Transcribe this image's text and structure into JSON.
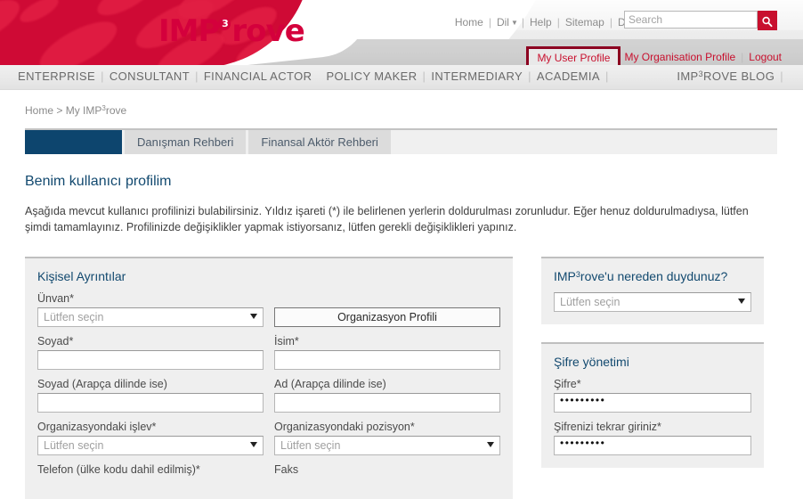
{
  "brand": {
    "logo_main": "IMP",
    "logo_sup": "3",
    "logo_tail": "rove",
    "accent_red": "#c8102e",
    "accent_blue": "#12496f",
    "highlight_border": "#8c0020"
  },
  "header": {
    "util_links": [
      "Home",
      "Dil",
      "Help",
      "Sitemap",
      "Disclaimer"
    ],
    "lang_caret": "▼",
    "search": {
      "placeholder": "Search",
      "value": "",
      "icon": "search-icon"
    },
    "profile_links": {
      "my_user_profile": "My User Profile",
      "my_organisation_profile": "My Organisation Profile",
      "logout": "Logout"
    }
  },
  "mainnav": {
    "left_items": [
      "ENTERPRISE",
      "CONSULTANT",
      "FINANCIAL ACTOR",
      "POLICY MAKER",
      "INTERMEDIARY",
      "ACADEMIA"
    ],
    "right_item": {
      "pre": "IMP",
      "sup": "3",
      "post": "ROVE BLOG"
    }
  },
  "breadcrumb": {
    "home": "Home",
    "separator": ">",
    "current_pre": "My IMP",
    "current_sup": "3",
    "current_post": "rove"
  },
  "tabs": [
    {
      "label": "",
      "active": true
    },
    {
      "label": "Danışman Rehberi",
      "active": false
    },
    {
      "label": "Finansal Aktör Rehberi",
      "active": false
    }
  ],
  "page": {
    "title": "Benim kullanıcı profilim",
    "intro": "Aşağıda mevcut kullanıcı profilinizi bulabilirsiniz. Yıldız işareti (*) ile belirlenen yerlerin doldurulması zorunludur. Eğer henuz doldurulmadıysa, lütfen şimdi tamamlayınız. Profilinizde değişiklikler yapmak istiyorsanız, lütfen gerekli değişiklikleri yapınız."
  },
  "personal_details": {
    "heading": "Kişisel Ayrıntılar",
    "select_placeholder": "Lütfen seçin",
    "org_profile_button": "Organizasyon Profili",
    "labels": {
      "title": "Ünvan*",
      "surname": "Soyad*",
      "firstname": "İsim*",
      "surname_arabic": "Soyad (Arapça dilinde ise)",
      "firstname_arabic": "Ad (Arapça dilinde ise)",
      "function": "Organizasyondaki işlev*",
      "position": "Organizasyondaki pozisyon*",
      "phone": "Telefon (ülke kodu dahil edilmiş)*",
      "fax": "Faks"
    },
    "values": {
      "title": "",
      "surname": "",
      "firstname": "",
      "surname_arabic": "",
      "firstname_arabic": "",
      "function": "",
      "position": ""
    }
  },
  "how_heard": {
    "heading_pre": "IMP",
    "heading_sup": "3",
    "heading_post": "rove'u nereden duydunuz?",
    "select_placeholder": "Lütfen seçin",
    "value": ""
  },
  "password_management": {
    "heading": "Şifre yönetimi",
    "labels": {
      "password": "Şifre*",
      "password_repeat": "Şifrenizi tekrar giriniz*"
    },
    "values": {
      "password": "•••••••••",
      "password_repeat": "•••••••••"
    }
  }
}
